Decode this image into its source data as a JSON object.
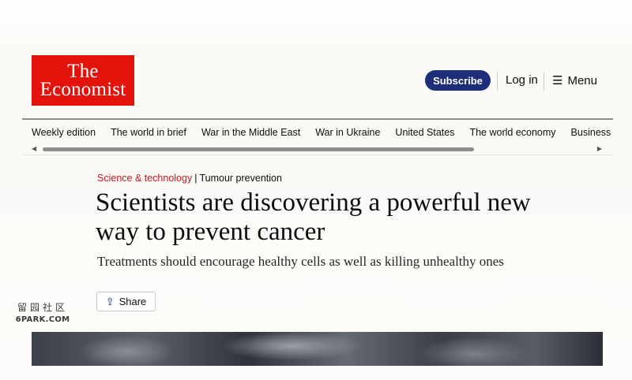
{
  "header": {
    "logo_line1": "The",
    "logo_line2": "Economist",
    "subscribe_label": "Subscribe",
    "login_label": "Log in",
    "menu_label": "Menu",
    "menu_icon": "menu-search-icon",
    "brand_color": "#e3120b",
    "accent_color": "#1f2e7a"
  },
  "nav": {
    "items": [
      {
        "label": "Weekly edition"
      },
      {
        "label": "The world in brief"
      },
      {
        "label": "War in the Middle East"
      },
      {
        "label": "War in Ukraine"
      },
      {
        "label": "United States"
      },
      {
        "label": "The world economy"
      },
      {
        "label": "Business"
      }
    ]
  },
  "article": {
    "section": "Science & technology",
    "separator": "|",
    "topic": "Tumour prevention",
    "headline": "Scientists are discovering a powerful new way to prevent cancer",
    "subheadline": "Treatments should encourage healthy cells as well as killing unhealthy ones",
    "share_label": "Share",
    "section_color": "#c4161c"
  },
  "watermark": {
    "chinese": "留园社区",
    "site": "6PARK.COM"
  }
}
